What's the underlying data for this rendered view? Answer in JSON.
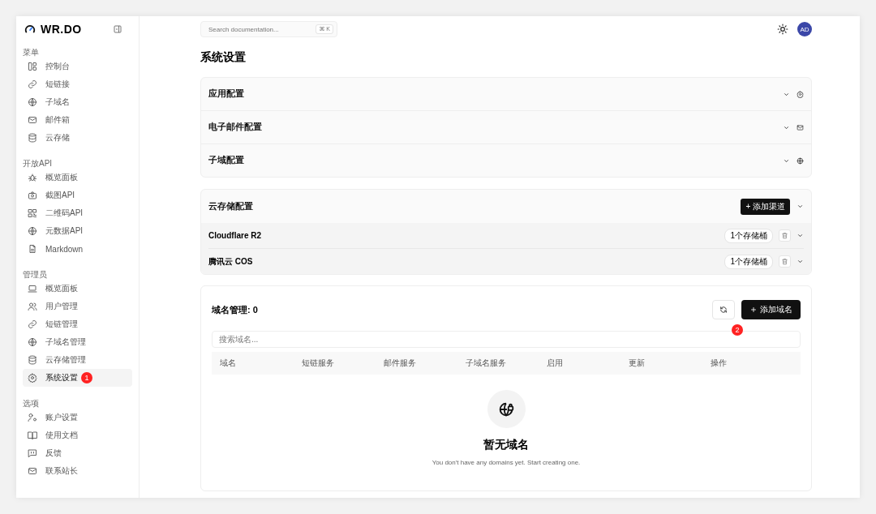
{
  "brand": {
    "name": "WR.DO"
  },
  "sidebar": {
    "sections": [
      {
        "label": "菜单",
        "items": [
          {
            "label": "控制台",
            "kind": "layout",
            "selected": false
          },
          {
            "label": "短链接",
            "kind": "link",
            "selected": false
          },
          {
            "label": "子域名",
            "kind": "globe",
            "selected": false
          },
          {
            "label": "邮件箱",
            "kind": "mail",
            "selected": false
          },
          {
            "label": "云存储",
            "kind": "database",
            "selected": false
          }
        ]
      },
      {
        "label": "开放API",
        "items": [
          {
            "label": "概览面板",
            "kind": "bug",
            "selected": false
          },
          {
            "label": "截图API",
            "kind": "camera",
            "selected": false
          },
          {
            "label": "二维码API",
            "kind": "qr",
            "selected": false
          },
          {
            "label": "元数据API",
            "kind": "globe",
            "selected": false
          },
          {
            "label": "Markdown",
            "kind": "file",
            "selected": false
          }
        ]
      },
      {
        "label": "管理员",
        "items": [
          {
            "label": "概览面板",
            "kind": "laptop",
            "selected": false
          },
          {
            "label": "用户管理",
            "kind": "users",
            "selected": false
          },
          {
            "label": "短链管理",
            "kind": "link",
            "selected": false
          },
          {
            "label": "子域名管理",
            "kind": "globe",
            "selected": false
          },
          {
            "label": "云存储管理",
            "kind": "database",
            "selected": false
          },
          {
            "label": "系统设置",
            "kind": "gear",
            "selected": true,
            "marker": "1"
          }
        ]
      },
      {
        "label": "选项",
        "items": [
          {
            "label": "账户设置",
            "kind": "user-gear",
            "selected": false
          },
          {
            "label": "使用文档",
            "kind": "book",
            "selected": false
          },
          {
            "label": "反馈",
            "kind": "message",
            "selected": false
          },
          {
            "label": "联系站长",
            "kind": "mail",
            "selected": false
          }
        ]
      }
    ]
  },
  "topbar": {
    "search": {
      "placeholder": "Search documentation...",
      "shortcut": "⌘ K"
    },
    "avatar": "AD"
  },
  "page_title": "系统设置",
  "config_sections": [
    {
      "title": "应用配置",
      "kind": "gear",
      "expanded": false
    },
    {
      "title": "电子邮件配置",
      "kind": "mail",
      "expanded": false
    },
    {
      "title": "子域配置",
      "kind": "globe",
      "expanded": false
    }
  ],
  "storage": {
    "title": "云存储配置",
    "add_button": "+ 添加渠道",
    "expanded": true,
    "providers": [
      {
        "name": "Cloudflare R2",
        "count": "1个存储桶"
      },
      {
        "name": "腾讯云 COS",
        "count": "1个存储桶"
      }
    ]
  },
  "domains": {
    "title": "域名管理: 0",
    "add_button": "添加域名",
    "marker": "2",
    "search": {
      "placeholder": "搜索域名..."
    },
    "table": {
      "columns": [
        "域名",
        "短链服务",
        "邮件服务",
        "子域名服务",
        "启用",
        "更新",
        "操作"
      ]
    },
    "empty": {
      "title": "暂无域名",
      "text": "You don't have any domains yet. Start creating one."
    }
  }
}
